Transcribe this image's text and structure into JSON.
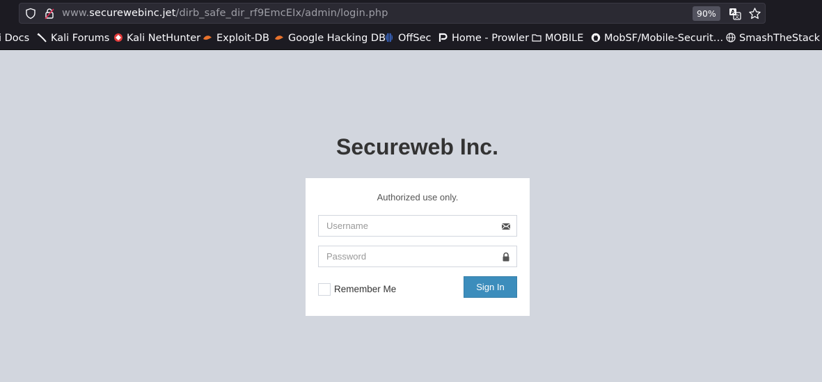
{
  "browser": {
    "url_prefix": "www.",
    "url_host": "securewebinc.jet",
    "url_path": "/dirb_safe_dir_rf9EmcEIx/admin/login.php",
    "zoom": "90%",
    "bookmarks": [
      {
        "label": "i Docs",
        "icon": "kali-docs-icon"
      },
      {
        "label": "Kali Forums",
        "icon": "kali-dragon-icon"
      },
      {
        "label": "Kali NetHunter",
        "icon": "nethunter-icon"
      },
      {
        "label": "Exploit-DB",
        "icon": "exploit-db-icon"
      },
      {
        "label": "Google Hacking DB",
        "icon": "ghdb-icon"
      },
      {
        "label": "OffSec",
        "icon": "offsec-icon"
      },
      {
        "label": "Home - Prowler",
        "icon": "prowler-icon"
      },
      {
        "label": "MOBILE",
        "icon": "folder-icon"
      },
      {
        "label": "MobSF/Mobile-Securit…",
        "icon": "github-icon"
      },
      {
        "label": "SmashTheStack W",
        "icon": "globe-icon"
      }
    ]
  },
  "page": {
    "title": "Secureweb Inc.",
    "message": "Authorized use only.",
    "username_placeholder": "Username",
    "password_placeholder": "Password",
    "remember_label": "Remember Me",
    "signin_label": "Sign In"
  },
  "colors": {
    "page_bg": "#d2d6de",
    "primary": "#3c8dbc",
    "chrome_bg": "#1c1b22"
  }
}
